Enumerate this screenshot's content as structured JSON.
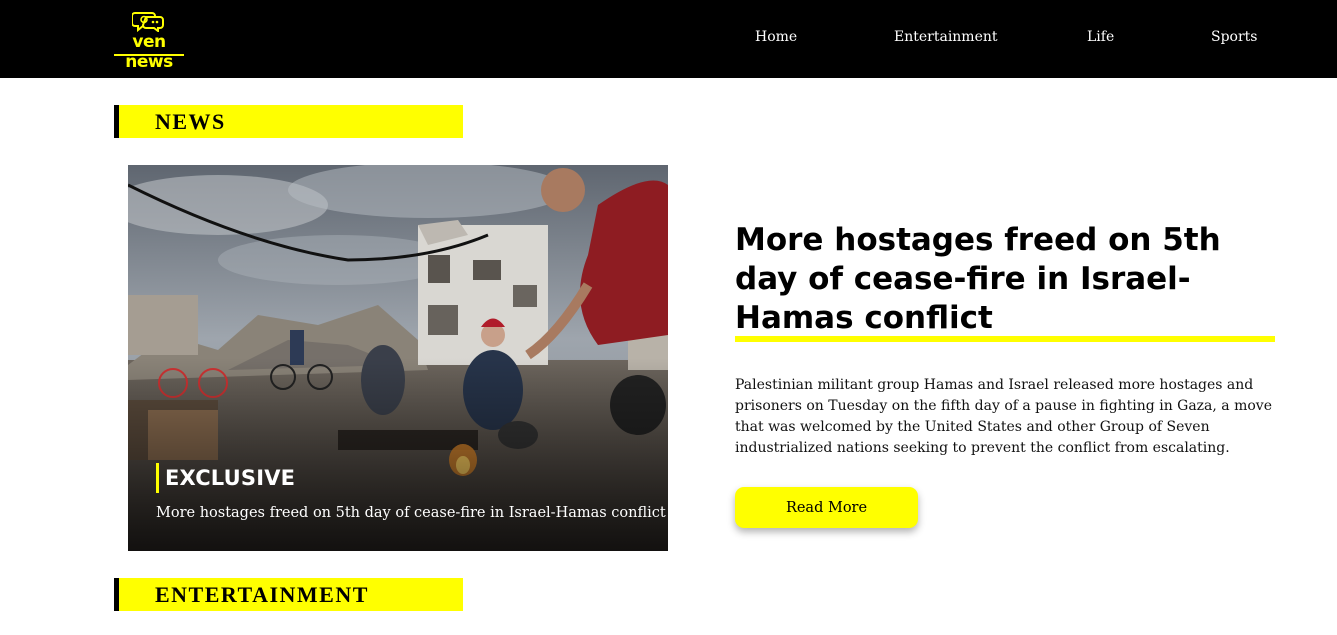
{
  "header": {
    "logo_text": "ven news",
    "nav": [
      "Home",
      "Entertainment",
      "Life",
      "Sports"
    ]
  },
  "sections": {
    "news_title": "NEWS",
    "entertainment_title": "ENTERTAINMENT"
  },
  "featured": {
    "badge": "EXCLUSIVE",
    "image_caption": "More hostages freed on 5th day of cease-fire in Israel-Hamas conflict",
    "headline": "More hostages freed on 5th day of cease-fire in Israel-Hamas conflict",
    "summary": "Palestinian militant group Hamas and Israel released more hostages and prisoners on Tuesday on the fifth day of a pause in fighting in Gaza, a move that was welcomed by the United States and other Group of Seven industrialized nations seeking to prevent the conflict from escalating.",
    "button_label": "Read More"
  },
  "colors": {
    "accent": "#ffff00",
    "header_bg": "#000000",
    "page_bg": "#ffffff"
  },
  "icons": [
    "speech-bubbles-logo-icon"
  ]
}
